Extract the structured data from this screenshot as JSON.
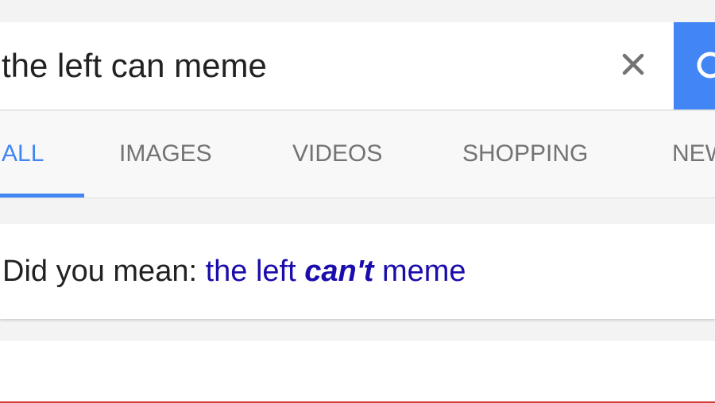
{
  "search": {
    "query": "the left can meme",
    "clear_icon": "close-icon",
    "search_icon": "search-icon",
    "accent_color": "#4285f4"
  },
  "tabs": [
    {
      "label": "ALL",
      "active": true
    },
    {
      "label": "IMAGES",
      "active": false
    },
    {
      "label": "VIDEOS",
      "active": false
    },
    {
      "label": "SHOPPING",
      "active": false
    },
    {
      "label": "NEWS",
      "active": false
    }
  ],
  "did_you_mean": {
    "prefix": "Did you mean:",
    "suggestion_before": "the left",
    "suggestion_emphasis": "can't",
    "suggestion_after": "meme",
    "link_color": "#1a0dab"
  }
}
